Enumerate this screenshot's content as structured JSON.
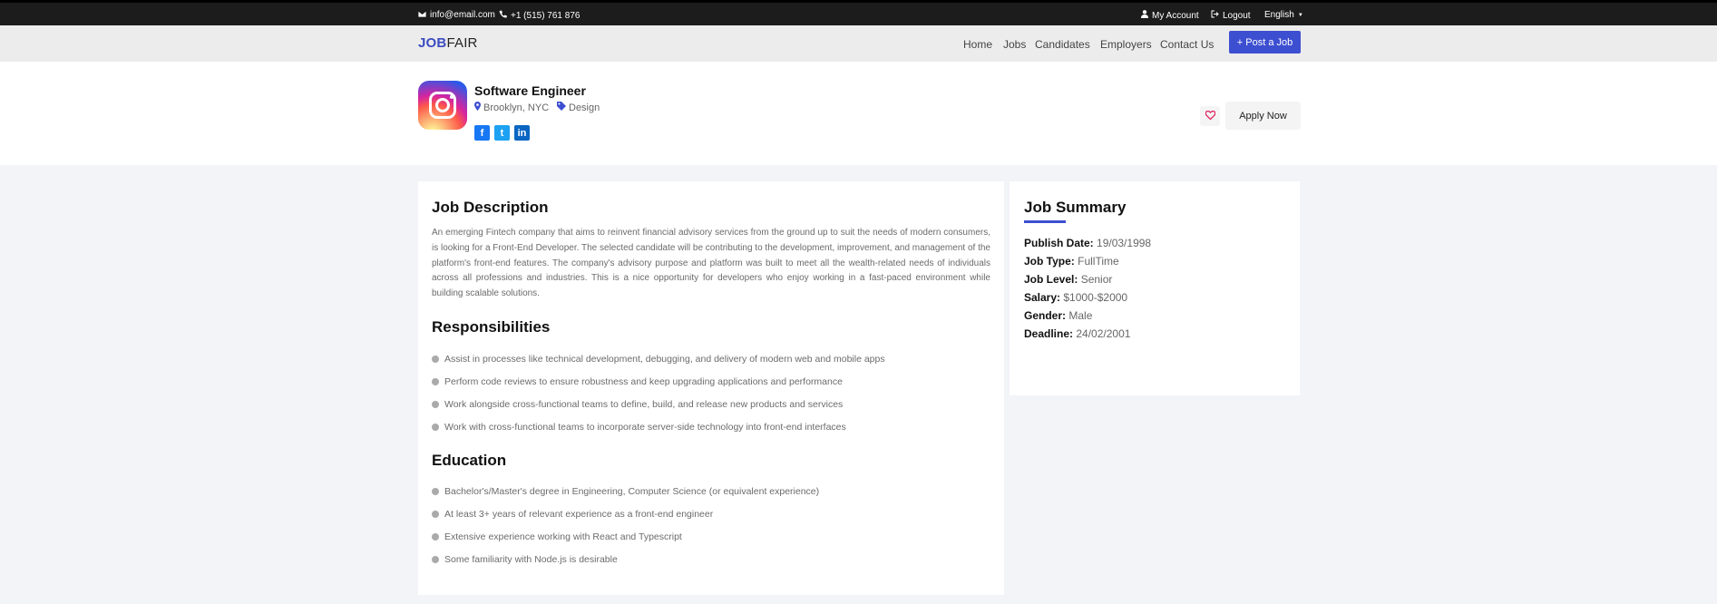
{
  "topbar": {
    "email": "info@email.com",
    "phone": "+1 (515) 761 876",
    "account": "My Account",
    "logout": "Logout",
    "language": "English"
  },
  "nav": {
    "logo_brand": "JOB",
    "logo_rest": "FAIR",
    "links": [
      "Home",
      "Jobs",
      "Candidates",
      "Employers",
      "Contact Us"
    ],
    "post_button": "+ Post a Job"
  },
  "job": {
    "title": "Software Engineer",
    "location": "Brooklyn, NYC",
    "category": "Design",
    "apply_button": "Apply Now",
    "social": [
      {
        "icon": "facebook-icon",
        "glyph": "f",
        "color": "#1877f2"
      },
      {
        "icon": "twitter-icon",
        "glyph": "t",
        "color": "#1da1f2"
      },
      {
        "icon": "linkedin-icon",
        "glyph": "in",
        "color": "#0a66c2"
      }
    ]
  },
  "description": {
    "heading": "Job Description",
    "text": "An emerging Fintech company that aims to reinvent financial advisory services from the ground up to suit the needs of modern consumers, is looking for a Front-End Developer. The selected candidate will be contributing to the development, improvement, and management of the platform's front-end features. The company's advisory purpose and platform was built to meet all the wealth-related needs of individuals across all professions and industries. This is a nice opportunity for developers who enjoy working in a fast-paced environment while building scalable solutions."
  },
  "responsibilities": {
    "heading": "Responsibilities",
    "items": [
      "Assist in processes like technical development, debugging, and delivery of modern web and mobile apps",
      "Perform code reviews to ensure robustness and keep upgrading applications and performance",
      "Work alongside cross-functional teams to define, build, and release new products and services",
      "Work with cross-functional teams to incorporate server-side technology into front-end interfaces"
    ]
  },
  "education": {
    "heading": "Education",
    "items": [
      "Bachelor's/Master's degree in Engineering, Computer Science (or equivalent experience)",
      "At least 3+ years of relevant experience as a front-end engineer",
      "Extensive experience working with React and Typescript",
      "Some familiarity with Node.js is desirable"
    ]
  },
  "summary": {
    "heading": "Job Summary",
    "rows": [
      {
        "label": "Publish Date:",
        "value": "19/03/1998"
      },
      {
        "label": "Job Type:",
        "value": "FullTime"
      },
      {
        "label": "Job Level:",
        "value": "Senior"
      },
      {
        "label": "Salary:",
        "value": "$1000-$2000"
      },
      {
        "label": "Gender:",
        "value": "Male"
      },
      {
        "label": "Deadline:",
        "value": "24/02/2001"
      }
    ]
  },
  "colors": {
    "accent": "#3d4fd1",
    "heart": "#e0245e"
  }
}
